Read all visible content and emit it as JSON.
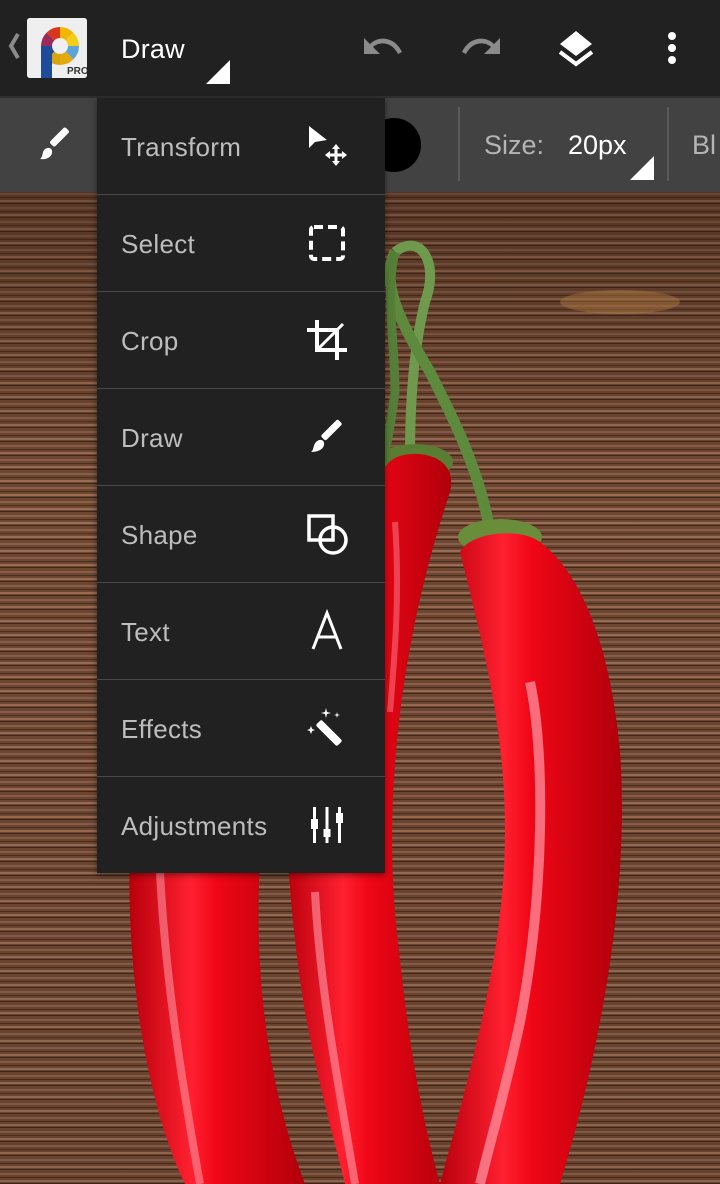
{
  "appbar": {
    "mode_title": "Draw",
    "icons": {
      "back": "chevron-left-icon",
      "logo": "photoshop-touch-pro-logo",
      "logo_badge": "PRO",
      "undo": "undo-icon",
      "redo": "redo-icon",
      "layers": "layers-icon",
      "overflow": "more-vertical-icon"
    }
  },
  "toolbar": {
    "brush_icon": "brush-icon",
    "color": "#000000",
    "size_label": "Size:",
    "size_value": "20px",
    "blend_label_partial": "Bl"
  },
  "menu": {
    "items": [
      {
        "label": "Transform",
        "icon": "transform-move-icon"
      },
      {
        "label": "Select",
        "icon": "dashed-selection-icon"
      },
      {
        "label": "Crop",
        "icon": "crop-icon"
      },
      {
        "label": "Draw",
        "icon": "brush-icon"
      },
      {
        "label": "Shape",
        "icon": "shape-square-circle-icon"
      },
      {
        "label": "Text",
        "icon": "text-a-icon"
      },
      {
        "label": "Effects",
        "icon": "magic-wand-icon"
      },
      {
        "label": "Adjustments",
        "icon": "sliders-icon"
      }
    ]
  },
  "canvas": {
    "subject": "Red chili peppers on wooden table",
    "colors": {
      "wood": "#6b4631",
      "pepper": "#e00010",
      "stem": "#5e8a3e"
    }
  },
  "colors": {
    "appbar_bg": "#212121",
    "toolbar_bg": "#424242",
    "menu_bg": "#212121",
    "menu_text": "#bdbdbd",
    "icon_white": "#ffffff",
    "icon_disabled": "#8a8a8a"
  }
}
